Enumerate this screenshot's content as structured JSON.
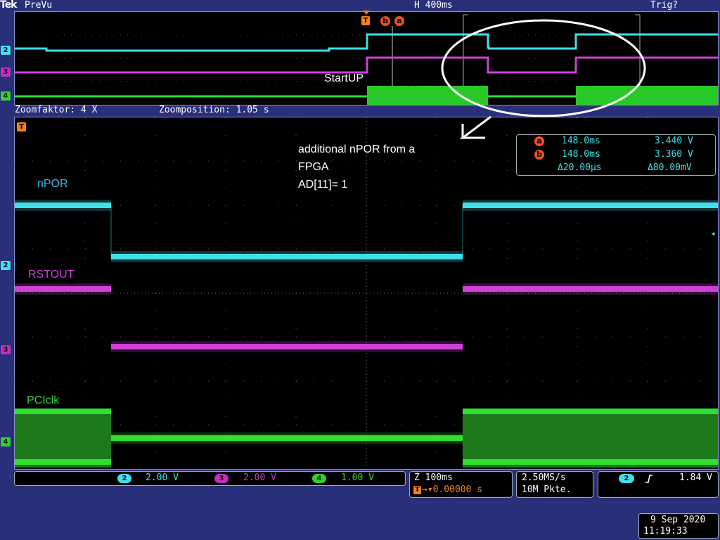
{
  "header": {
    "logo": "Tek",
    "mode": "PreVu",
    "horizontal_scale": "H 400ms",
    "trigger_status": "Trig?"
  },
  "overview": {
    "annotation": "StartUP",
    "trigger_marker": "T",
    "cursor_b_marker": "b",
    "cursor_a_marker": "a"
  },
  "zoom": {
    "factor_label": "Zoomfaktor: 4 X",
    "position_label": "Zoomposition: 1.05 s"
  },
  "channels": {
    "ch2": {
      "marker": "2",
      "label": "nPOR",
      "color": "#40e0e8",
      "scale": "2.00 V"
    },
    "ch3": {
      "marker": "3",
      "label": "RSTOUT",
      "color": "#d040d8",
      "scale": "2.00 V"
    },
    "ch4": {
      "marker": "4",
      "label": "PCIclk",
      "color": "#30e030",
      "scale": "1.00 V"
    }
  },
  "main_annotation": {
    "line1": "additional nPOR from a",
    "line2": "FPGA",
    "line3": "AD[11]= 1"
  },
  "cursors": {
    "a_label": "a",
    "a_time": "148.0ms",
    "a_volt": "3.440 V",
    "b_label": "b",
    "b_time": "148.0ms",
    "b_volt": "3.360 V",
    "delta_time": "Δ20.00µs",
    "delta_volt": "Δ80.00mV"
  },
  "timebase": {
    "zoom_scale": "Z 100ms",
    "trigger_position": "0.00000 s",
    "sample_rate": "2.50MS/s",
    "record_length": "10M Pkte."
  },
  "trigger": {
    "source": "2",
    "slope_icon": "rising-edge-icon",
    "level": "1.84 V"
  },
  "datetime": {
    "date": "9 Sep  2020",
    "time": "11:19:33"
  }
}
